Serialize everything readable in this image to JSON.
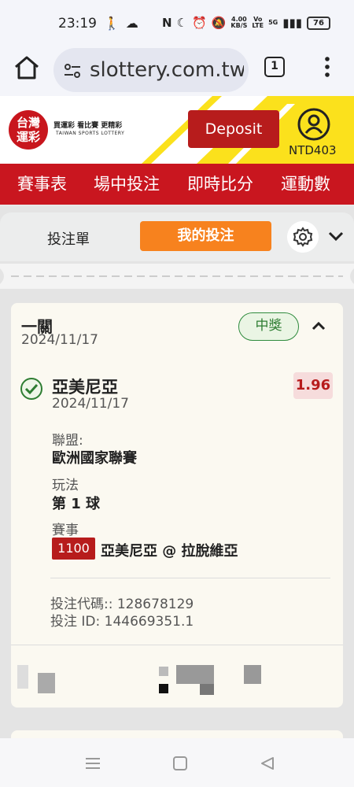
{
  "status_bar": {
    "time": "23:19",
    "net_speed": "4.00",
    "net_unit": "KB/S",
    "signal_type": "5G",
    "battery": "76"
  },
  "browser": {
    "url": "slottery.com.tw",
    "tab_count": "1"
  },
  "site_header": {
    "logo_main": "台灣運彩",
    "logo_tagline": "買運彩 看比賽 更精彩",
    "logo_english": "TAIWAN SPORTS LOTTERY",
    "deposit_label": "Deposit",
    "balance": "NTD403"
  },
  "nav": {
    "items": [
      "賽事表",
      "場中投注",
      "即時比分",
      "運動數"
    ]
  },
  "bet_panel": {
    "tab_slip": "投注單",
    "tab_mine": "我的投注"
  },
  "bet_card": {
    "title": "一關",
    "date": "2024/11/17",
    "status": "中獎",
    "selection": {
      "name": "亞美尼亞",
      "date": "2024/11/17",
      "odds": "1.96",
      "league_label": "聯盟:",
      "league": "歐洲國家聯賽",
      "market_label": "玩法",
      "market": "第 1 球",
      "event_label": "賽事",
      "event_code": "1100",
      "event_name": "亞美尼亞 @ 拉脫維亞"
    },
    "bet_code_line": "投注代碼:: 128678129",
    "bet_id_line": "投注 ID: 144669351.1"
  }
}
